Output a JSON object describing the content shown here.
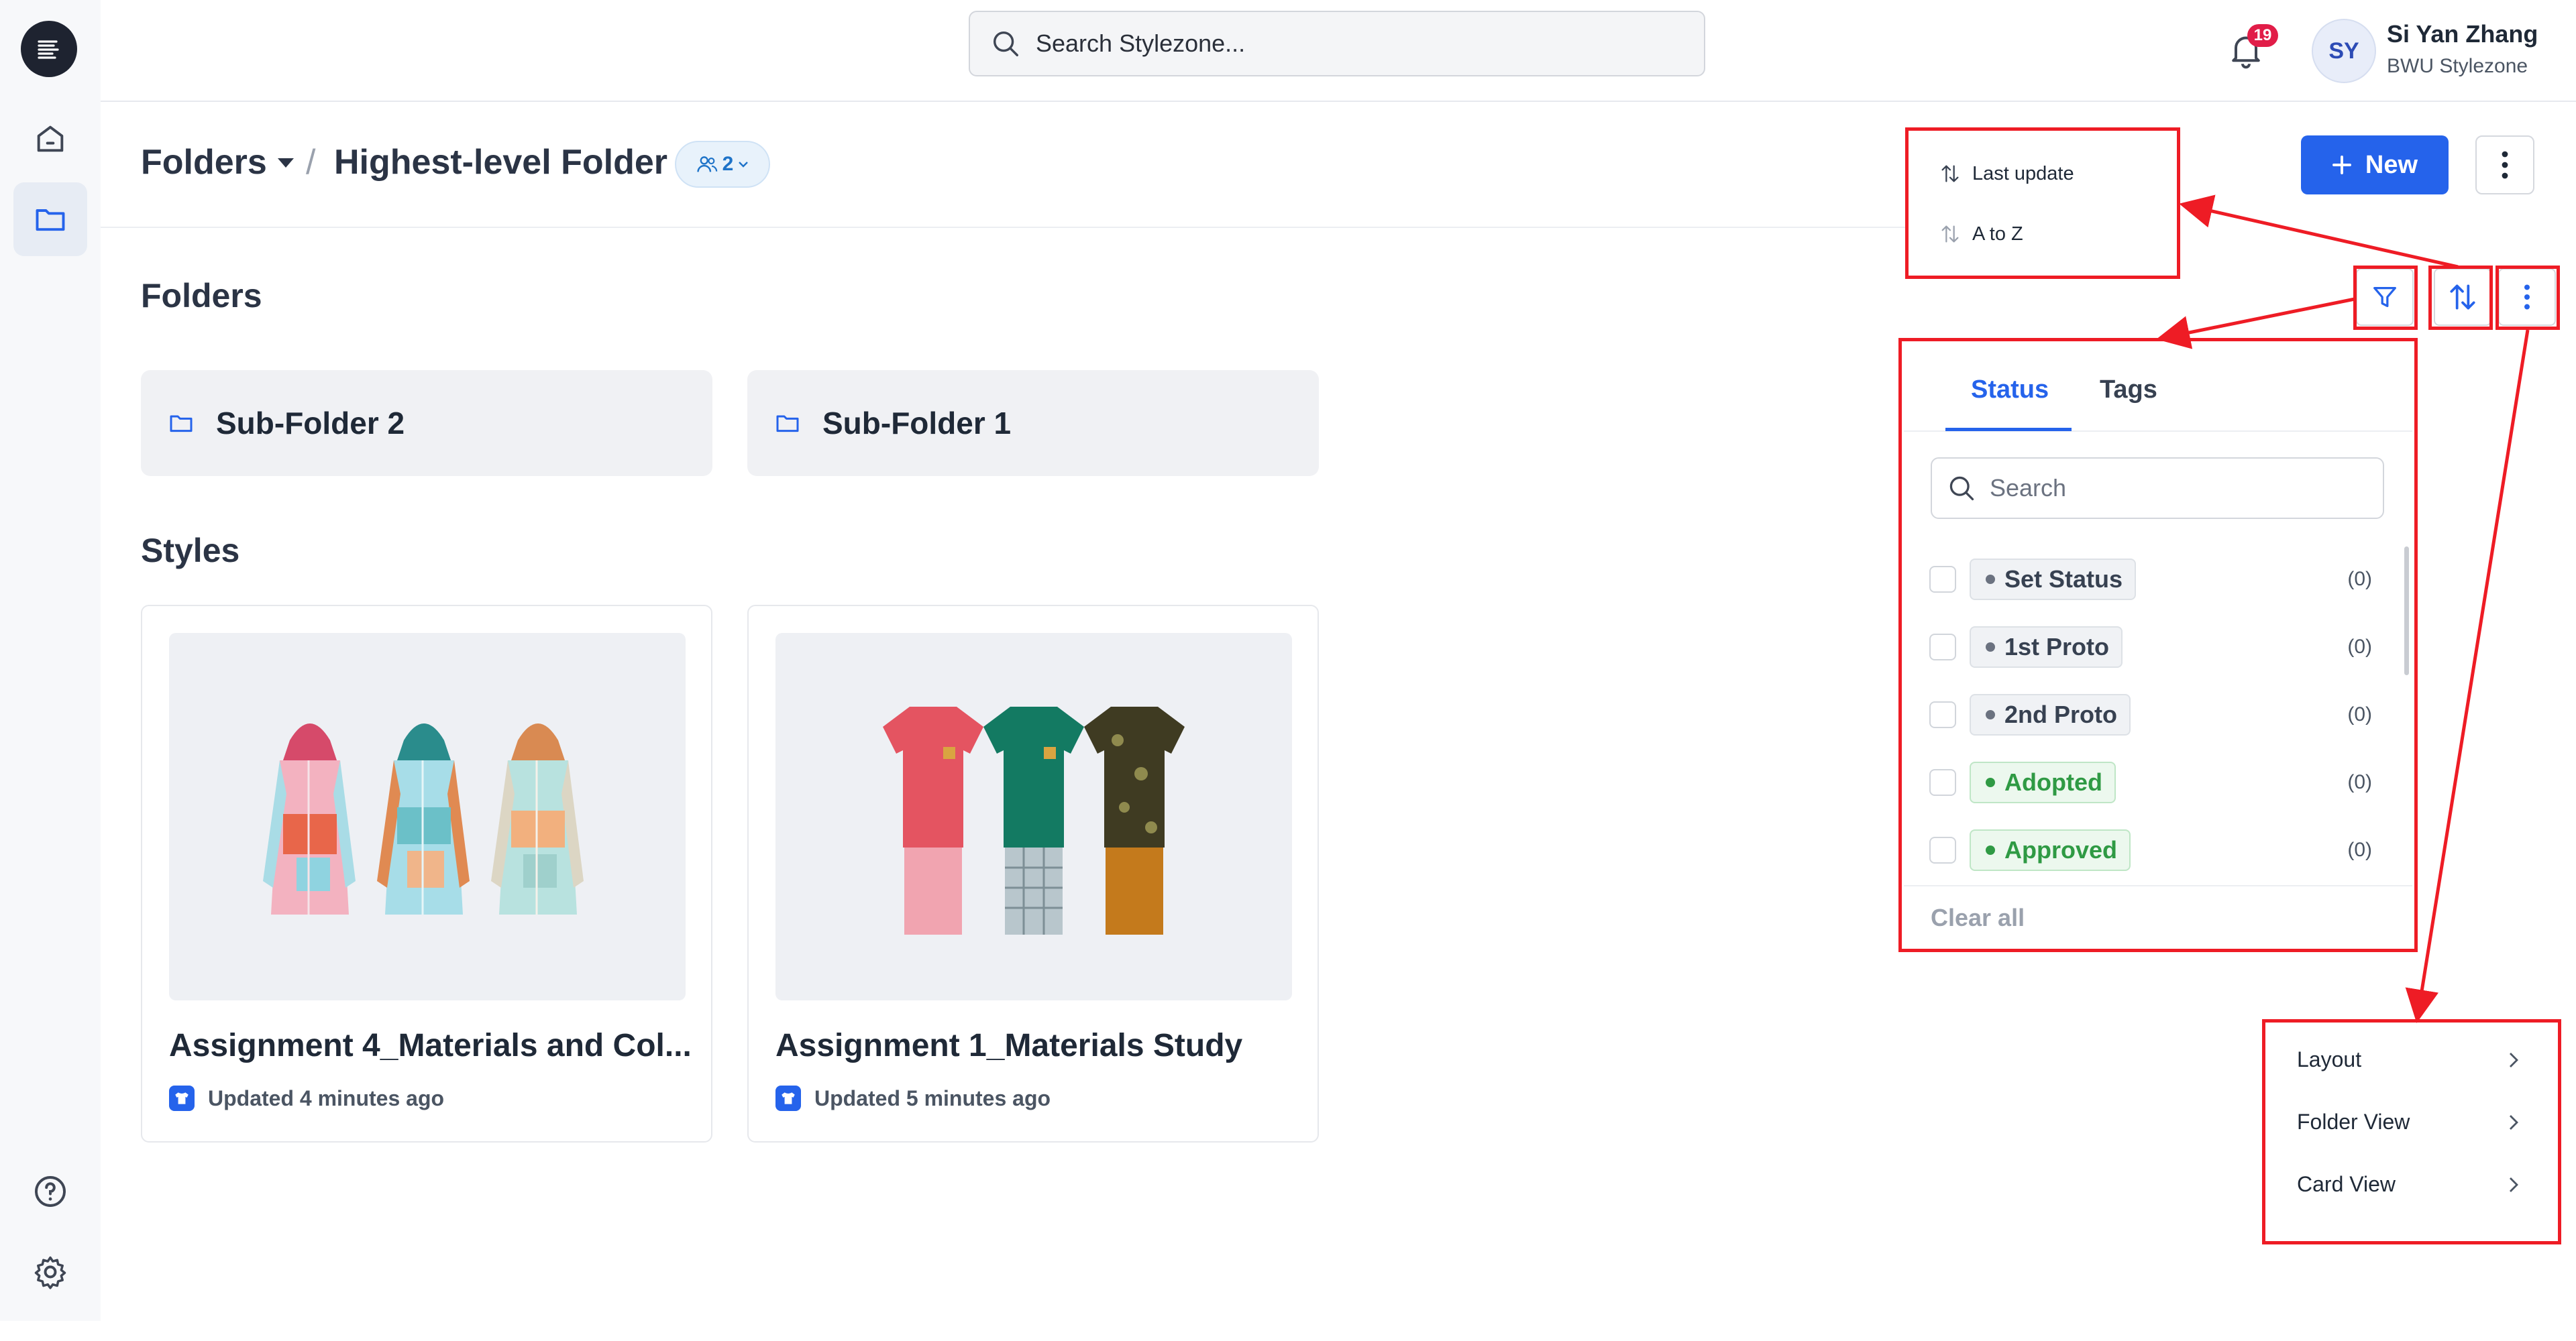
{
  "search": {
    "placeholder": "Search Stylezone..."
  },
  "notifications": {
    "count": "19"
  },
  "user": {
    "initials": "SY",
    "name": "Si Yan Zhang",
    "org": "BWU Stylezone"
  },
  "breadcrumb": {
    "root": "Folders",
    "separator": "/",
    "current": "Highest-level Folder",
    "members_count": "2"
  },
  "toolbar": {
    "new_label": "New"
  },
  "sections": {
    "folders_title": "Folders",
    "styles_title": "Styles"
  },
  "folders": [
    {
      "label": "Sub-Folder 2"
    },
    {
      "label": "Sub-Folder 1"
    }
  ],
  "styles": [
    {
      "name": "Assignment 4_Materials and Col...",
      "updated": "Updated 4 minutes ago"
    },
    {
      "name": "Assignment 1_Materials Study",
      "updated": "Updated 5 minutes ago"
    }
  ],
  "sort_menu": {
    "items": [
      "Last update",
      "A to Z"
    ]
  },
  "filter": {
    "tabs": [
      "Status",
      "Tags"
    ],
    "active_tab": "Status",
    "search_placeholder": "Search",
    "statuses": [
      {
        "label": "Set Status",
        "count": "(0)",
        "color": "#6b7280"
      },
      {
        "label": "1st Proto",
        "count": "(0)",
        "color": "#6b7280"
      },
      {
        "label": "2nd Proto",
        "count": "(0)",
        "color": "#6b7280"
      },
      {
        "label": "Adopted",
        "count": "(0)",
        "color": "#2f9a44"
      },
      {
        "label": "Approved",
        "count": "(0)",
        "color": "#2f9a44"
      }
    ],
    "clear_all": "Clear all"
  },
  "more_menu": {
    "items": [
      "Layout",
      "Folder View",
      "Card View"
    ]
  },
  "colors": {
    "accent": "#2563eb",
    "annotation": "#ee1c25"
  }
}
